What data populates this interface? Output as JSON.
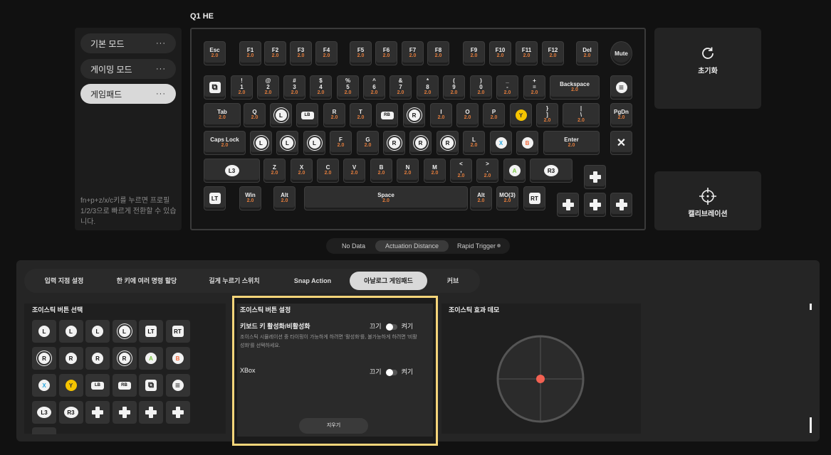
{
  "device_title": "Q1 HE",
  "modes": [
    {
      "label": "기본 모드",
      "more": "···"
    },
    {
      "label": "게이밍 모드",
      "more": "···"
    },
    {
      "label": "게임패드",
      "more": "···"
    }
  ],
  "hint_text": "fn+p+z/x/c키를 누르면 프로필 1/2/3으로 빠르게 전환할 수 있습니다.",
  "side": {
    "reset": "초기화",
    "calibration": "캘리브레이션"
  },
  "view_modes": {
    "no_data": "No Data",
    "actuation": "Actuation Distance",
    "rapid": "Rapid Trigger"
  },
  "tabs": [
    "입력 지점 설정",
    "한 키에 여러 명령 할당",
    "길게 누르기 스위치",
    "Snap Action",
    "아날로그 게임패드",
    "커브"
  ],
  "joystick_select_title": "조이스틱 버튼 선택",
  "settings": {
    "title": "조이스틱 버튼 설정",
    "kb_toggle_label": "키보드 키 활성화/비활성화",
    "off": "끄기",
    "on": "켜기",
    "description": "조이스틱 시뮬레이션 중 타이핑이 가능하게 하려면 '활성화'를, 불가능하게 하려면 '비활성화'를 선택하세요.",
    "xbox_label": "XBox",
    "clear": "지우기"
  },
  "demo_title": "조이스틱 효과 데모",
  "keys": {
    "esc": "Esc",
    "f1": "F1",
    "f2": "F2",
    "f3": "F3",
    "f4": "F4",
    "f5": "F5",
    "f6": "F6",
    "f7": "F7",
    "f8": "F8",
    "f9": "F9",
    "f10": "F10",
    "f11": "F11",
    "f12": "F12",
    "del": "Del",
    "mute": "Mute",
    "k1": "!\n1",
    "k2": "@\n2",
    "k3": "#\n3",
    "k4": "$\n4",
    "k5": "%\n5",
    "k6": "^\n6",
    "k7": "&\n7",
    "k8": "*\n8",
    "k9": "(\n9",
    "k0": ")\n0",
    "minus": "_\n-",
    "equal": "+\n=",
    "backspace": "Backspace",
    "tab": "Tab",
    "q": "Q",
    "r": "R",
    "t": "T",
    "i": "I",
    "o": "O",
    "p": "P",
    "lbrace": "}\n]",
    "pipe": "|\n\\",
    "pgdn": "PgDn",
    "caps": "Caps Lock",
    "f": "F",
    "g": "G",
    "l": "L",
    "enter": "Enter",
    "z": "Z",
    "x": "X",
    "c": "C",
    "v": "V",
    "b": "B",
    "n": "N",
    "m": "M",
    "lt": "<\n,",
    "gt": ">\n.",
    "win": "Win",
    "alt": "Alt",
    "space": "Space",
    "alt2": "Alt",
    "mo3": "MO(3)"
  },
  "actuation": "2.0",
  "gamepad_labels": {
    "L": "L",
    "R": "R",
    "LB": "LB",
    "RB": "RB",
    "LT": "LT",
    "RT": "RT",
    "L3": "L3",
    "R3": "R3",
    "A": "A",
    "B": "B",
    "X": "X",
    "Y": "Y"
  },
  "colors": {
    "accent_orange": "#e07b3c",
    "highlight": "#f5d57a",
    "a_green": "#7ac943",
    "b_orange": "#f26a3d",
    "x_blue": "#29a8e0",
    "y_yellow": "#f5c400",
    "dot_red": "#f26152"
  }
}
